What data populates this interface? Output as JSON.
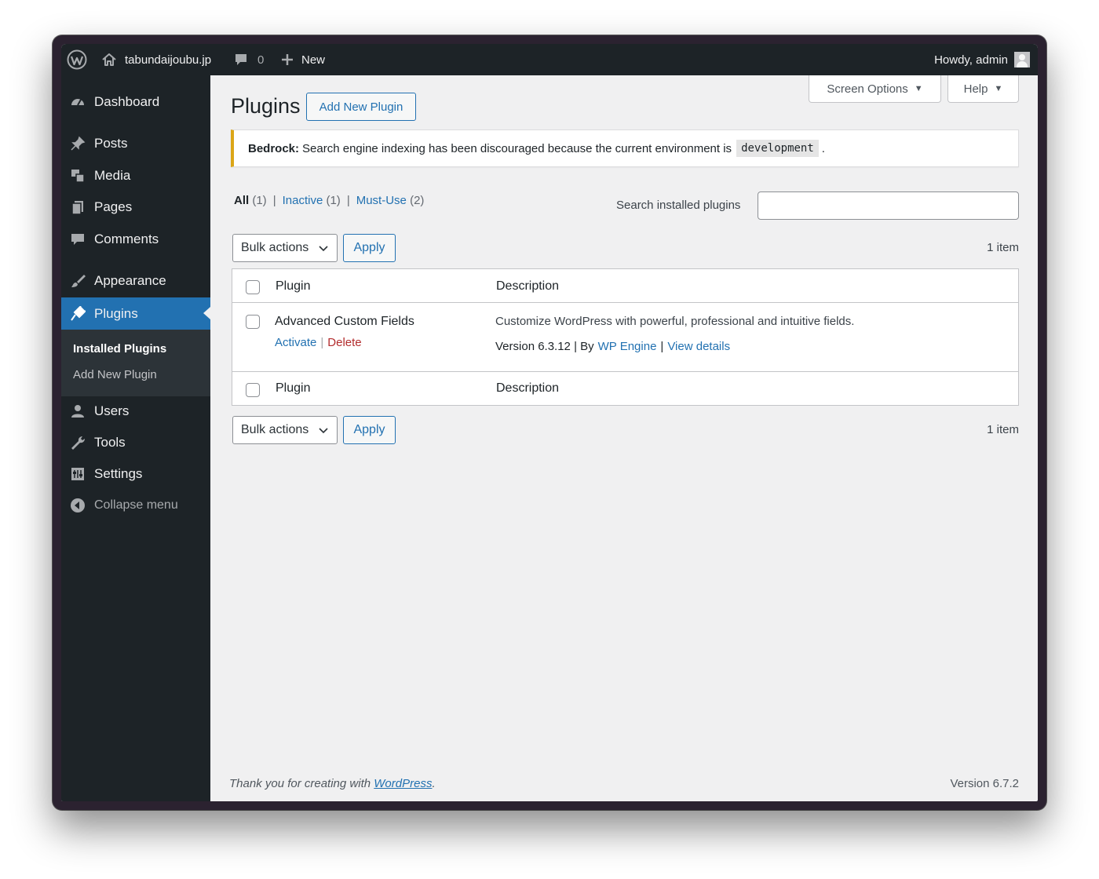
{
  "adminbar": {
    "site_name": "tabundaijoubu.jp",
    "comments_count": "0",
    "new_label": "New",
    "howdy": "Howdy, admin"
  },
  "sidebar": {
    "items": [
      {
        "label": "Dashboard",
        "icon": "dashboard-icon"
      },
      {
        "label": "Posts",
        "icon": "pin-icon"
      },
      {
        "label": "Media",
        "icon": "media-icon"
      },
      {
        "label": "Pages",
        "icon": "pages-icon"
      },
      {
        "label": "Comments",
        "icon": "comment-icon"
      },
      {
        "label": "Appearance",
        "icon": "brush-icon"
      },
      {
        "label": "Plugins",
        "icon": "plugin-icon"
      },
      {
        "label": "Users",
        "icon": "user-icon"
      },
      {
        "label": "Tools",
        "icon": "wrench-icon"
      },
      {
        "label": "Settings",
        "icon": "settings-icon"
      },
      {
        "label": "Collapse menu",
        "icon": "collapse-icon"
      }
    ],
    "submenu": [
      {
        "label": "Installed Plugins"
      },
      {
        "label": "Add New Plugin"
      }
    ]
  },
  "header": {
    "screen_options": "Screen Options",
    "help": "Help",
    "title": "Plugins",
    "add_new": "Add New Plugin"
  },
  "notice": {
    "prefix": "Bedrock:",
    "text": "Search engine indexing has been discouraged because the current environment is",
    "code": "development",
    "suffix": "."
  },
  "filters": [
    {
      "label": "All",
      "count": "(1)"
    },
    {
      "label": "Inactive",
      "count": "(1)"
    },
    {
      "label": "Must-Use",
      "count": "(2)"
    }
  ],
  "search": {
    "label": "Search installed plugins",
    "value": ""
  },
  "bulk": {
    "select": "Bulk actions",
    "apply": "Apply",
    "count": "1 item"
  },
  "table": {
    "columns": [
      "Plugin",
      "Description"
    ],
    "rows": [
      {
        "name": "Advanced Custom Fields",
        "activate": "Activate",
        "delete": "Delete",
        "description": "Customize WordPress with powerful, professional and intuitive fields.",
        "version": "Version 6.3.12 | By",
        "author": "WP Engine",
        "details": "View details"
      }
    ]
  },
  "footer": {
    "thanks_prefix": "Thank you for creating with",
    "thanks_link": "WordPress",
    "thanks_suffix": ".",
    "version": "Version 6.7.2"
  },
  "colors": {
    "accent": "#2271b1",
    "admin_dark": "#1d2327",
    "notice_warning": "#dba617",
    "delete": "#b32d2e"
  }
}
